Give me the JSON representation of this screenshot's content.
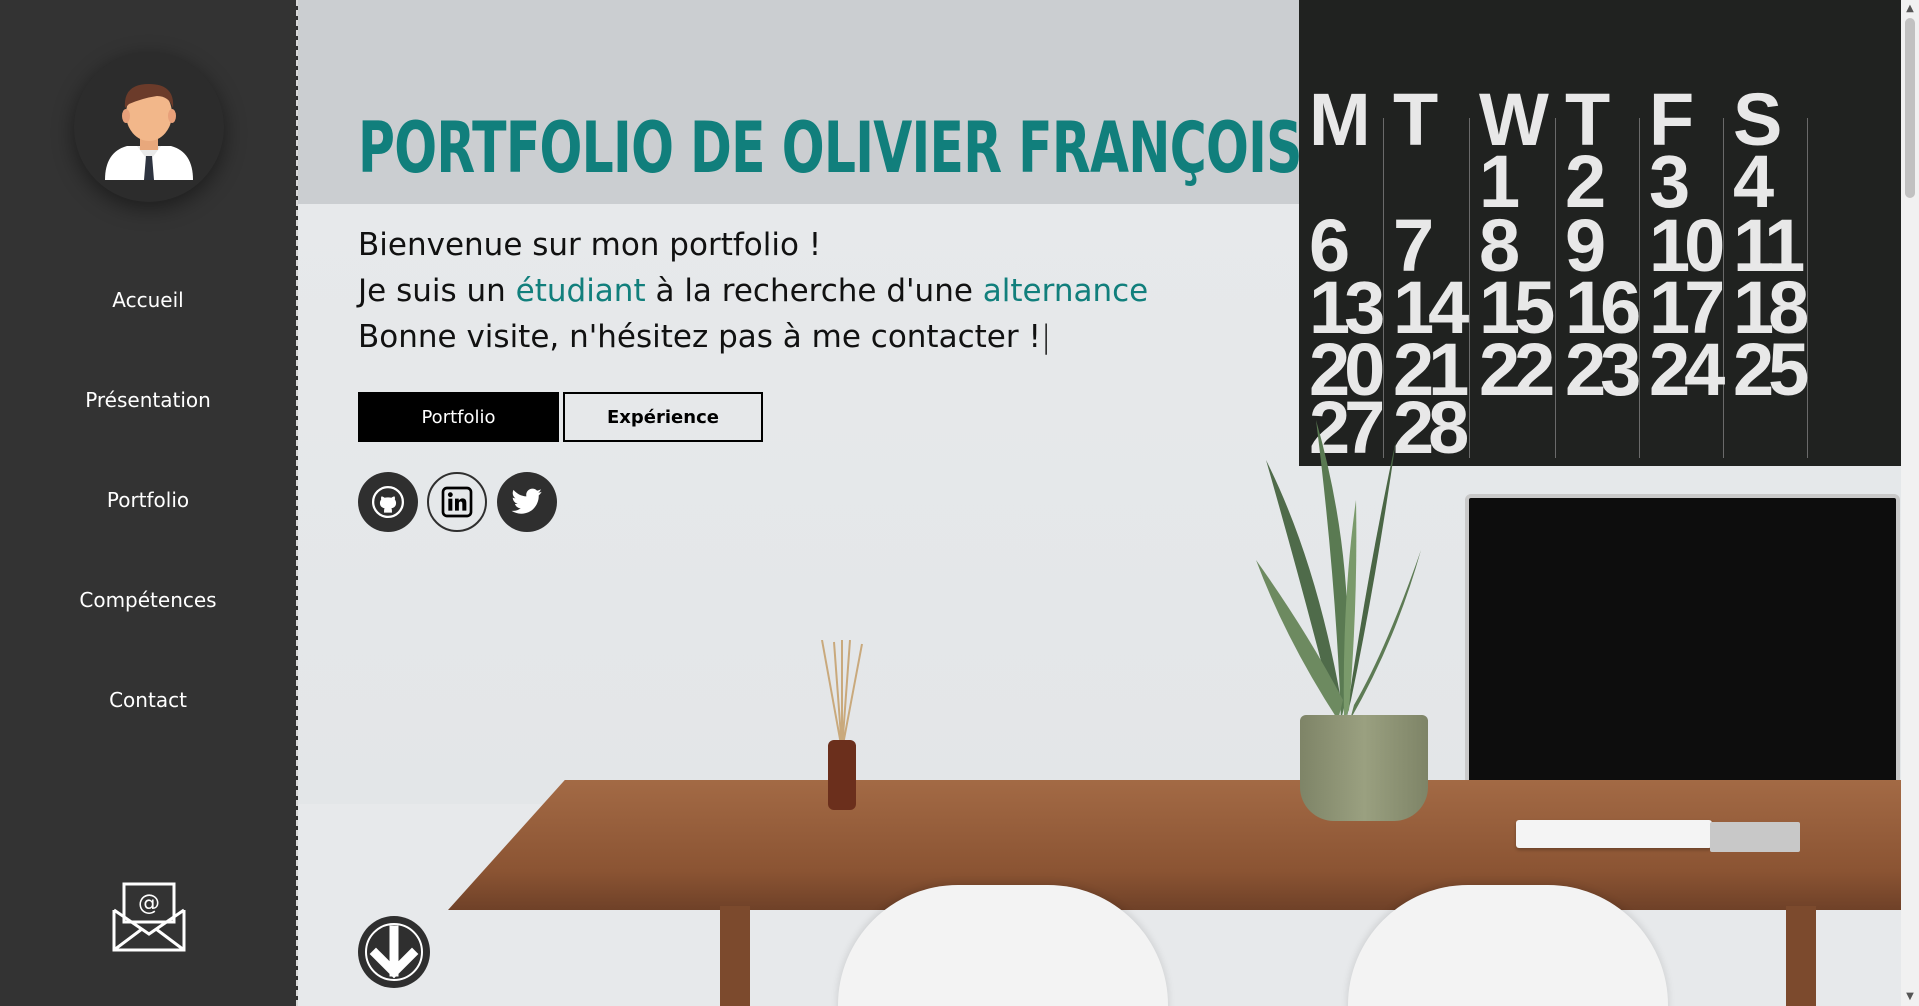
{
  "sidebar": {
    "items": [
      {
        "label": "Accueil"
      },
      {
        "label": "Présentation"
      },
      {
        "label": "Portfolio"
      },
      {
        "label": "Compétences"
      },
      {
        "label": "Contact"
      }
    ]
  },
  "hero": {
    "title": "PORTFOLIO DE OLIVIER FRANÇOIS",
    "line1": "Bienvenue sur mon portfolio !",
    "line2_prefix": "Je suis un ",
    "line2_highlight1": "étudiant",
    "line2_middle": " à la recherche d'une ",
    "line2_highlight2": "alternance",
    "line3": "Bonne visite, n'hésitez pas à me contacter !",
    "cursor": "|",
    "buttons": {
      "portfolio": "Portfolio",
      "experience": "Expérience"
    }
  },
  "calendar": {
    "days": [
      "M",
      "T",
      "W",
      "T",
      "F",
      "S"
    ],
    "rows": [
      [
        "",
        "",
        "1",
        "2",
        "3",
        "4"
      ],
      [
        "6",
        "7",
        "8",
        "9",
        "10",
        "11"
      ],
      [
        "13",
        "14",
        "15",
        "16",
        "17",
        "18"
      ],
      [
        "20",
        "21",
        "22",
        "23",
        "24",
        "25"
      ],
      [
        "27",
        "28",
        "",
        "",
        "",
        ""
      ]
    ]
  },
  "icons": {
    "avatar": "person-avatar-icon",
    "mail": "mail-envelope-icon",
    "github": "github-icon",
    "linkedin": "linkedin-icon",
    "twitter": "twitter-icon",
    "scroll": "arrow-down-icon"
  },
  "colors": {
    "accent": "#117f7c",
    "sidebar": "#333333",
    "button_dark": "#000000"
  }
}
